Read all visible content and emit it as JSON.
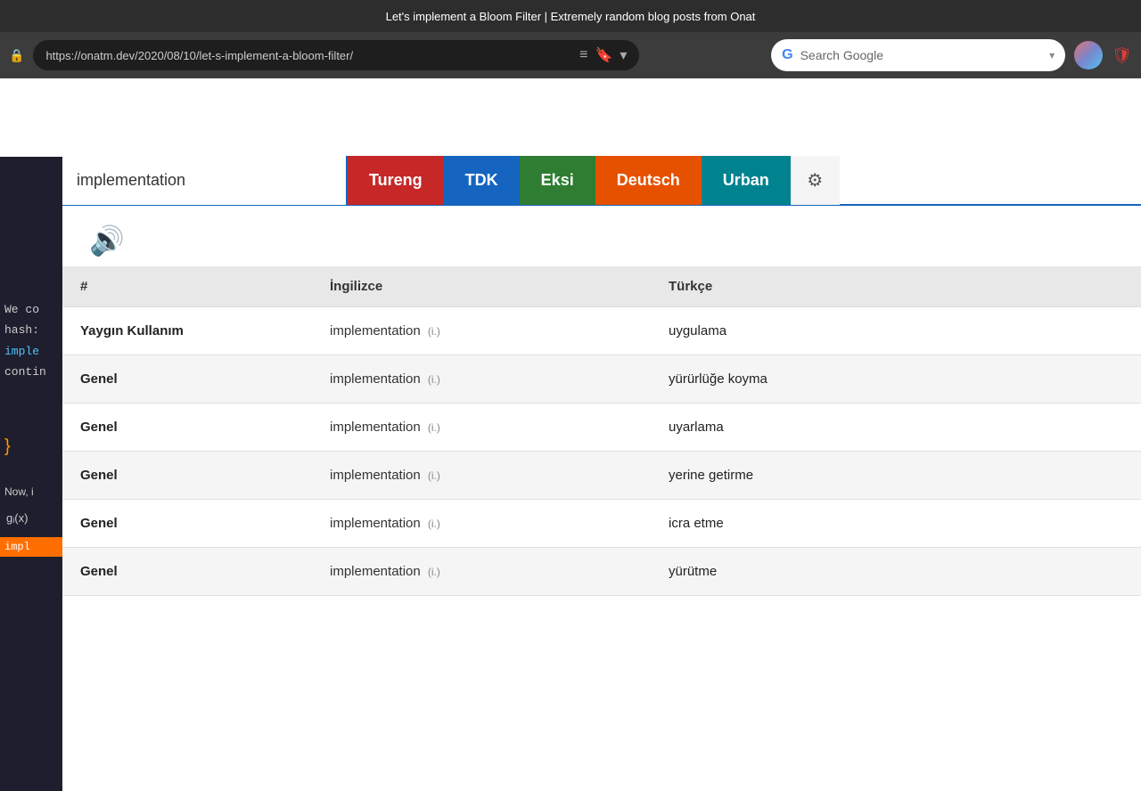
{
  "browser": {
    "title": "Let's implement a Bloom Filter | Extremely random blog posts from Onat",
    "url": "https://onatm.dev/2020/08/10/let-s-implement-a-bloom-filter/",
    "search_placeholder": "Search Google",
    "address_icons": [
      "≡",
      "🔖",
      "▾"
    ]
  },
  "background_blog": {
    "code_lines": [
      "We co",
      "hash:",
      "imple",
      "contin"
    ],
    "closing_brace": "}",
    "blog_texts": [
      "Now, i"
    ],
    "math_text": "gᵢ(x)",
    "code_snippet": "impl"
  },
  "dictionary": {
    "search_value": "implementation",
    "tabs": [
      {
        "key": "tureng",
        "label": "Tureng",
        "color": "#c62828"
      },
      {
        "key": "tdk",
        "label": "TDK",
        "color": "#1565c0"
      },
      {
        "key": "eksi",
        "label": "Eksi",
        "color": "#2e7d32"
      },
      {
        "key": "deutsch",
        "label": "Deutsch",
        "color": "#e65100"
      },
      {
        "key": "urban",
        "label": "Urban",
        "color": "#00838f"
      }
    ],
    "settings_icon": "⚙",
    "sound_icon": "🔊",
    "table": {
      "headers": [
        "#",
        "İngilizce",
        "Türkçe"
      ],
      "rows": [
        {
          "category": "Yaygın Kullanım",
          "english": "implementation",
          "type": "(i.)",
          "turkish": "uygulama",
          "bg": "white"
        },
        {
          "category": "Genel",
          "english": "implementation",
          "type": "(i.)",
          "turkish": "yürürlüğe koyma",
          "bg": "white"
        },
        {
          "category": "Genel",
          "english": "implementation",
          "type": "(i.)",
          "turkish": "uyarlama",
          "bg": "gray"
        },
        {
          "category": "Genel",
          "english": "implementation",
          "type": "(i.)",
          "turkish": "yerine getirme",
          "bg": "white"
        },
        {
          "category": "Genel",
          "english": "implementation",
          "type": "(i.)",
          "turkish": "icra etme",
          "bg": "gray"
        },
        {
          "category": "Genel",
          "english": "implementation",
          "type": "(i.)",
          "turkish": "yürütme",
          "bg": "white"
        }
      ]
    }
  }
}
